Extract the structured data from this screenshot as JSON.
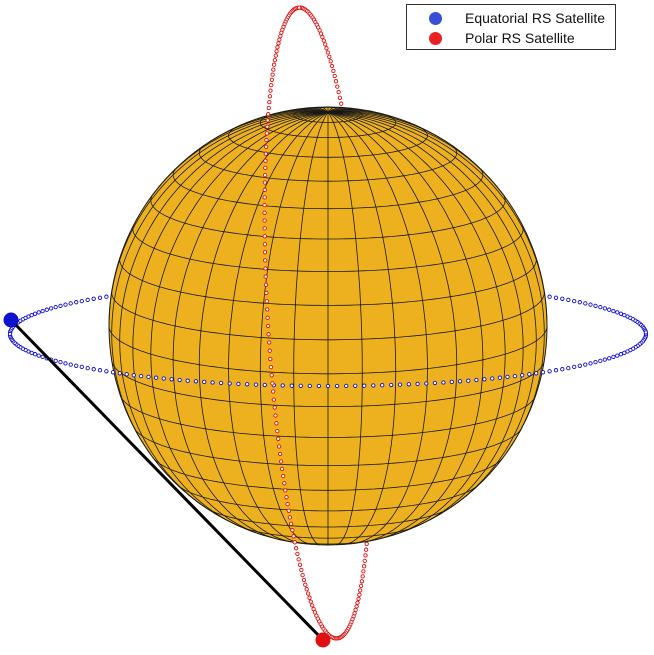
{
  "colors": {
    "sphere_fill": "#EDB120",
    "grid": "#1a1a1a",
    "equatorial": "#1010d0",
    "polar": "#e01010",
    "link": "#000000"
  },
  "legend": {
    "items": [
      {
        "label": "Equatorial RS Satellite",
        "color": "#3a4fd8"
      },
      {
        "label": "Polar RS Satellite",
        "color": "#e82020"
      }
    ]
  }
}
